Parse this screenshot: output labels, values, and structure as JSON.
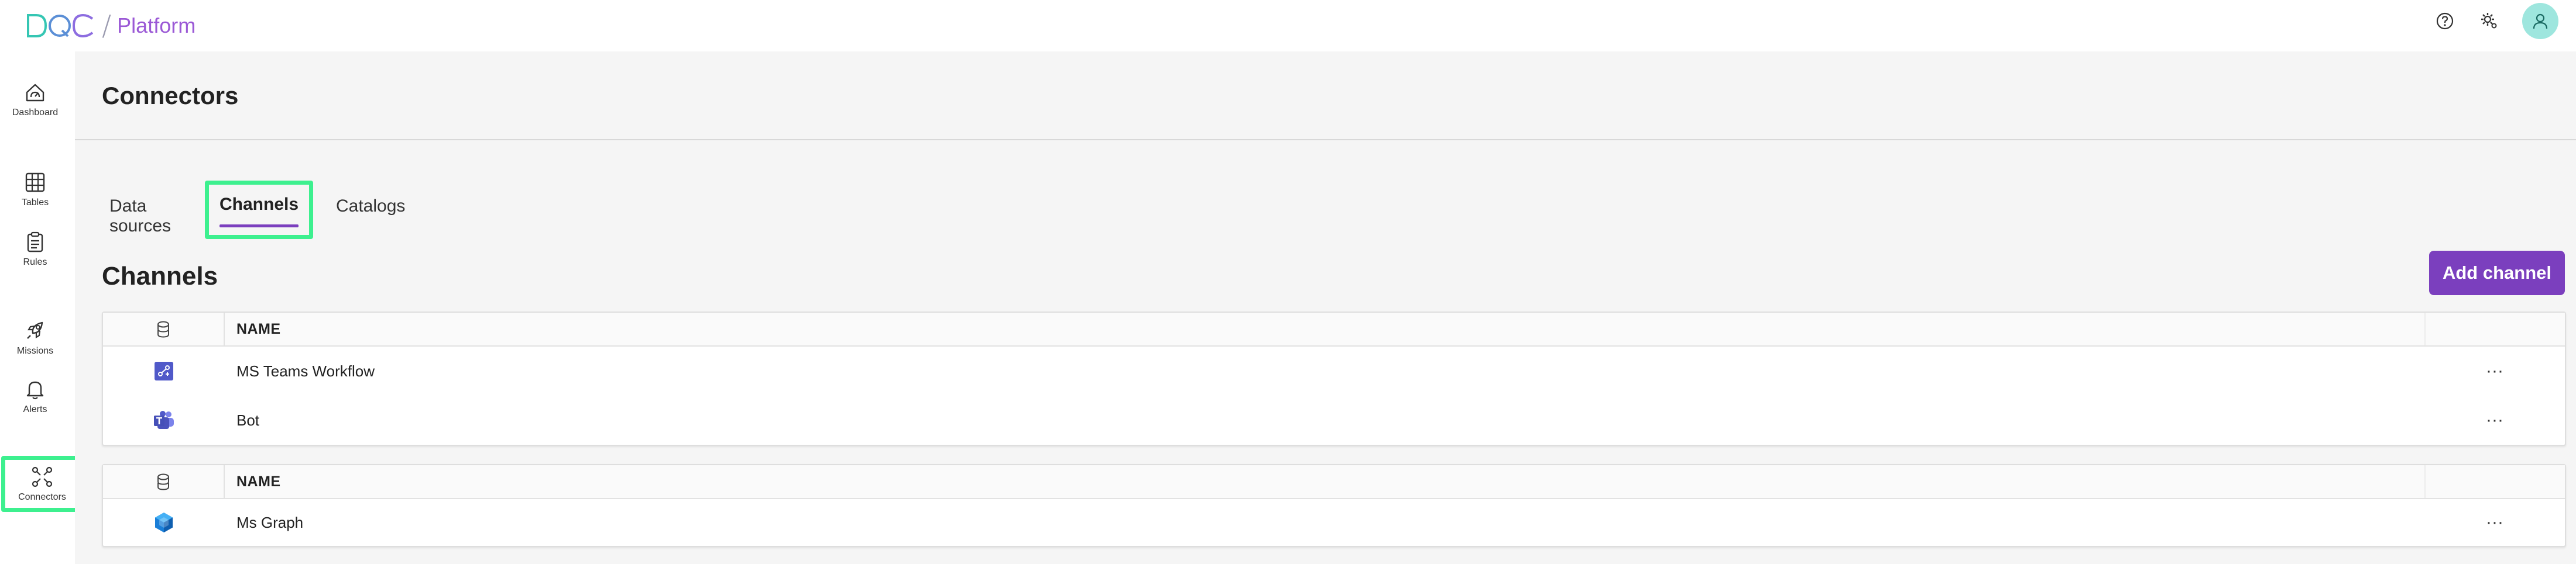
{
  "app": {
    "logo_text": "DQC",
    "slash": "/",
    "platform_label": "Platform"
  },
  "topbar": {
    "icons": [
      "help-icon",
      "settings-gear-icon",
      "user-avatar-icon"
    ]
  },
  "sidebar": {
    "items": [
      {
        "label": "Dashboard",
        "icon": "dashboard-icon"
      },
      {
        "label": "Tables",
        "icon": "table-grid-icon"
      },
      {
        "label": "Rules",
        "icon": "clipboard-icon"
      },
      {
        "label": "Missions",
        "icon": "rocket-icon"
      },
      {
        "label": "Alerts",
        "icon": "bell-icon"
      },
      {
        "label": "Connectors",
        "icon": "connectors-icon",
        "active": true
      }
    ]
  },
  "page": {
    "title": "Connectors",
    "tabs": [
      {
        "label": "Data sources"
      },
      {
        "label": "Channels",
        "active": true
      },
      {
        "label": "Catalogs"
      }
    ],
    "section_title": "Channels",
    "add_button": "Add channel"
  },
  "tables": [
    {
      "header": {
        "icon": "type-icon",
        "name": "NAME"
      },
      "rows": [
        {
          "icon": "ms-teams-workflow-icon",
          "name": "MS Teams Workflow",
          "actions": "···"
        },
        {
          "icon": "ms-teams-bot-icon",
          "name": "Bot",
          "actions": "···"
        }
      ]
    },
    {
      "header": {
        "icon": "type-icon",
        "name": "NAME"
      },
      "rows": [
        {
          "icon": "ms-graph-icon",
          "name": "Ms Graph",
          "actions": "···"
        }
      ]
    }
  ],
  "colors": {
    "accent": "#7b3fbe",
    "highlight": "#3df08f",
    "avatar": "#9ee6de",
    "background": "#f5f5f5"
  }
}
